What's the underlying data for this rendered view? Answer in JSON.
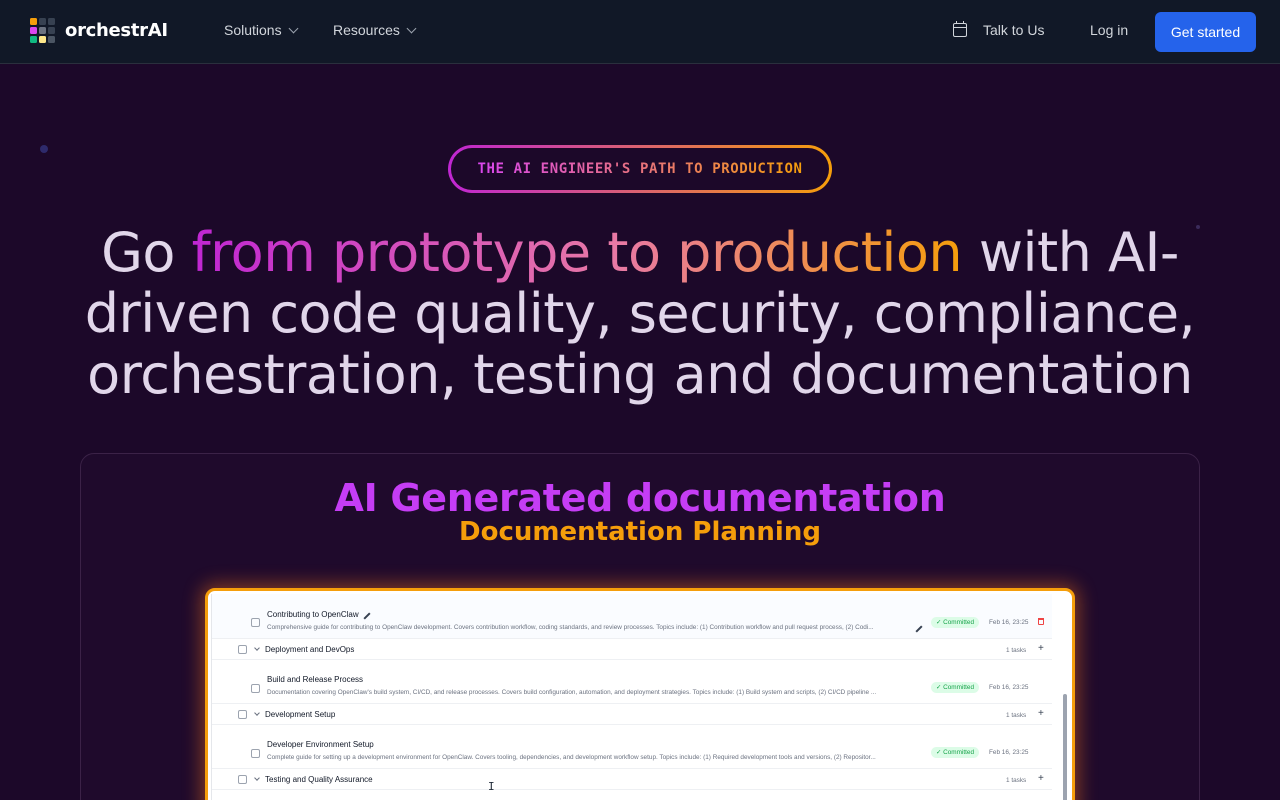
{
  "nav": {
    "brand": "orchestrAI",
    "solutions": "Solutions",
    "resources": "Resources",
    "talk": "Talk to Us",
    "login": "Log in",
    "cta": "Get started"
  },
  "colors": {
    "accent": "#2563eb",
    "background": "#1c0829",
    "gradient_start": "#c026d3",
    "gradient_end": "#f59e0b",
    "committed_bg": "#dcfce7",
    "committed_text": "#16a34a"
  },
  "hero": {
    "badge": "THE AI ENGINEER'S PATH TO PRODUCTION",
    "headline_pre": "Go ",
    "headline_highlight": "from prototype to production",
    "headline_post": " with AI-driven code quality, security, compliance, orchestration, testing and documentation"
  },
  "feature": {
    "title": "AI Generated documentation",
    "subtitle": "Documentation Planning"
  },
  "doc_list": {
    "rows": [
      {
        "type": "task",
        "title": "Contributing to OpenClaw",
        "description": "Comprehensive guide for contributing to OpenClaw development. Covers contribution workflow, coding standards, and review processes. Topics include: (1) Contribution workflow and pull request process, (2) Codi...",
        "status": "Committed",
        "date": "Feb 16, 23:25"
      },
      {
        "type": "group",
        "title": "Deployment and DevOps",
        "count": "1 tasks"
      },
      {
        "type": "task",
        "title": "Build and Release Process",
        "description": "Documentation covering OpenClaw's build system, CI/CD, and release processes. Covers build configuration, automation, and deployment strategies. Topics include: (1) Build system and scripts, (2) CI/CD pipeline ...",
        "status": "Committed",
        "date": "Feb 16, 23:25"
      },
      {
        "type": "group",
        "title": "Development Setup",
        "count": "1 tasks"
      },
      {
        "type": "task",
        "title": "Developer Environment Setup",
        "description": "Complete guide for setting up a development environment for OpenClaw. Covers tooling, dependencies, and development workflow setup. Topics include: (1) Required development tools and versions, (2) Repositor...",
        "status": "Committed",
        "date": "Feb 16, 23:25"
      },
      {
        "type": "group",
        "title": "Testing and Quality Assurance",
        "count": "1 tasks"
      }
    ]
  }
}
